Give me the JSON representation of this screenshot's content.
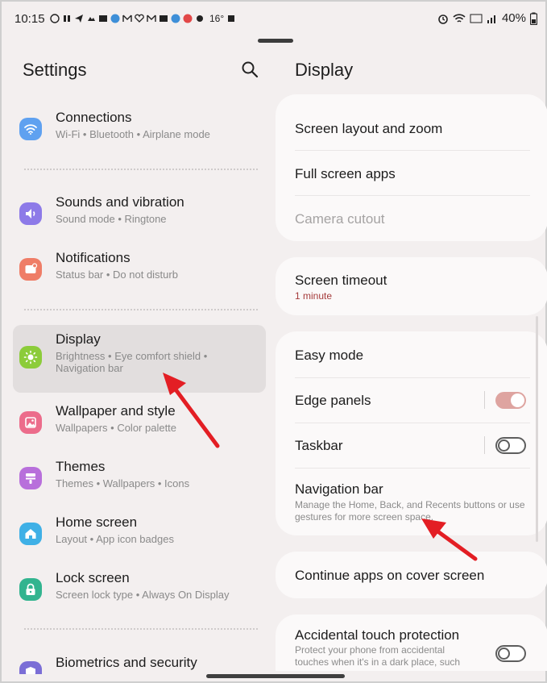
{
  "status_bar": {
    "time": "10:15",
    "temperature": "16°",
    "battery": "40%"
  },
  "left_panel": {
    "title": "Settings",
    "items": [
      {
        "title": "Connections",
        "subtitle": "Wi-Fi  •  Bluetooth  •  Airplane mode",
        "icon": "wifi-icon",
        "color": "#5fa1f0"
      },
      {
        "title": "Sounds and vibration",
        "subtitle": "Sound mode  •  Ringtone",
        "icon": "speaker-icon",
        "color": "#8d7ae8"
      },
      {
        "title": "Notifications",
        "subtitle": "Status bar  •  Do not disturb",
        "icon": "notification-icon",
        "color": "#ef7d67"
      },
      {
        "title": "Display",
        "subtitle": "Brightness  •  Eye comfort shield  •  Navigation bar",
        "icon": "sun-icon",
        "color": "#8ccc3a",
        "active": true
      },
      {
        "title": "Wallpaper and style",
        "subtitle": "Wallpapers  •  Color palette",
        "icon": "picture-icon",
        "color": "#ec6c8b"
      },
      {
        "title": "Themes",
        "subtitle": "Themes  •  Wallpapers  •  Icons",
        "icon": "paint-roller-icon",
        "color": "#b86fdb"
      },
      {
        "title": "Home screen",
        "subtitle": "Layout  •  App icon badges",
        "icon": "home-icon",
        "color": "#3fb0e6"
      },
      {
        "title": "Lock screen",
        "subtitle": "Screen lock type  •  Always On Display",
        "icon": "lock-icon",
        "color": "#32b48f"
      },
      {
        "title": "Biometrics and security",
        "subtitle": "",
        "icon": "shield-icon",
        "color": "#7b6ed6"
      }
    ]
  },
  "right_panel": {
    "title": "Display",
    "card1": {
      "items": [
        "Screen layout and zoom",
        "Full screen apps",
        "Camera cutout"
      ]
    },
    "card2": {
      "title": "Screen timeout",
      "value": "1 minute"
    },
    "card3": {
      "easy_mode": "Easy mode",
      "edge_panels": "Edge panels",
      "edge_panels_on": true,
      "taskbar": "Taskbar",
      "taskbar_on": false,
      "navigation_bar": "Navigation bar",
      "navigation_bar_desc": "Manage the Home, Back, and Recents buttons or use gestures for more screen space."
    },
    "card4": {
      "title": "Continue apps on cover screen"
    },
    "card5": {
      "title": "Accidental touch protection",
      "desc": "Protect your phone from accidental touches when it's in a dark place, such",
      "on": false
    }
  },
  "colors": {
    "background": "#f3efef",
    "card": "#fbf9f9",
    "active_row": "#e2dede",
    "toggle_on": "#dea4a0",
    "annotation_arrow": "#e31e24",
    "value_red": "#a53b3b"
  }
}
